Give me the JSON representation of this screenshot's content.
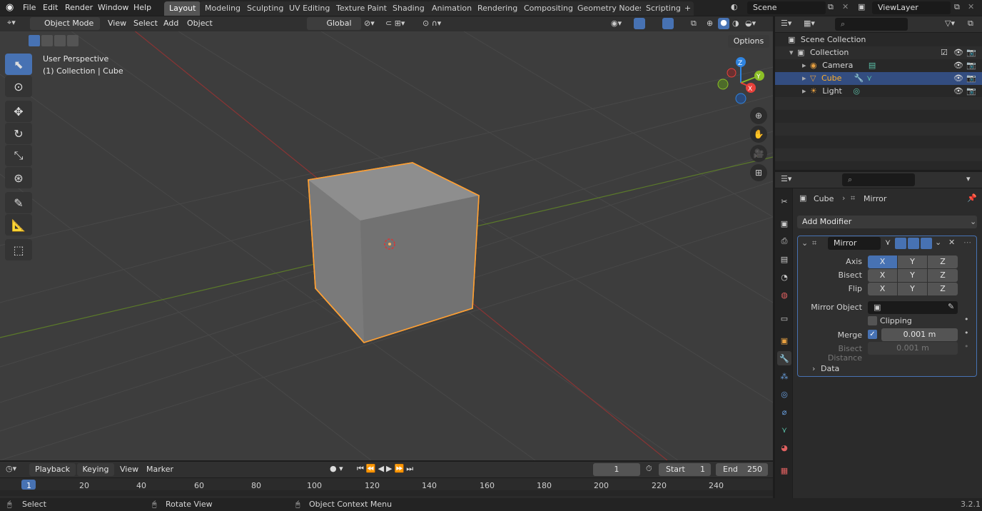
{
  "menu": {
    "file": "File",
    "edit": "Edit",
    "render": "Render",
    "window": "Window",
    "help": "Help"
  },
  "workspaces": [
    "Layout",
    "Modeling",
    "Sculpting",
    "UV Editing",
    "Texture Paint",
    "Shading",
    "Animation",
    "Rendering",
    "Compositing",
    "Geometry Nodes",
    "Scripting"
  ],
  "scene": "Scene",
  "view_layer": "ViewLayer",
  "viewport_header": {
    "mode": "Object Mode",
    "view": "View",
    "select": "Select",
    "add": "Add",
    "object": "Object",
    "orientation": "Global",
    "options": "Options"
  },
  "overlay": {
    "perspective": "User Perspective",
    "collection": "(1) Collection | Cube"
  },
  "gizmo": {
    "x": "X",
    "y": "Y",
    "z": "Z"
  },
  "outliner": {
    "scene_collection": "Scene Collection",
    "collection": "Collection",
    "camera": "Camera",
    "cube": "Cube",
    "light": "Light"
  },
  "properties": {
    "object": "Cube",
    "modifier": "Mirror",
    "add_modifier": "Add Modifier",
    "modifier_name": "Mirror",
    "axis": "Axis",
    "bisect": "Bisect",
    "flip": "Flip",
    "x": "X",
    "y": "Y",
    "z": "Z",
    "mirror_object": "Mirror Object",
    "clipping": "Clipping",
    "merge": "Merge",
    "merge_value": "0.001 m",
    "bisect_distance": "Bisect Distance",
    "bisect_value": "0.001 m",
    "data": "Data"
  },
  "timeline": {
    "playback": "Playback",
    "keying": "Keying",
    "view": "View",
    "marker": "Marker",
    "current_frame": "1",
    "start_label": "Start",
    "start": "1",
    "end_label": "End",
    "end": "250",
    "frames": [
      "1",
      "20",
      "40",
      "60",
      "80",
      "100",
      "120",
      "140",
      "160",
      "180",
      "200",
      "220",
      "240"
    ]
  },
  "status": {
    "select": "Select",
    "rotate": "Rotate View",
    "context": "Object Context Menu",
    "version": "3.2.1"
  },
  "colors": {
    "accent": "#4772b3",
    "selection": "#ffa033",
    "x_axis": "#e8413b",
    "y_axis": "#8cbf26",
    "z_axis": "#2f84e0"
  }
}
